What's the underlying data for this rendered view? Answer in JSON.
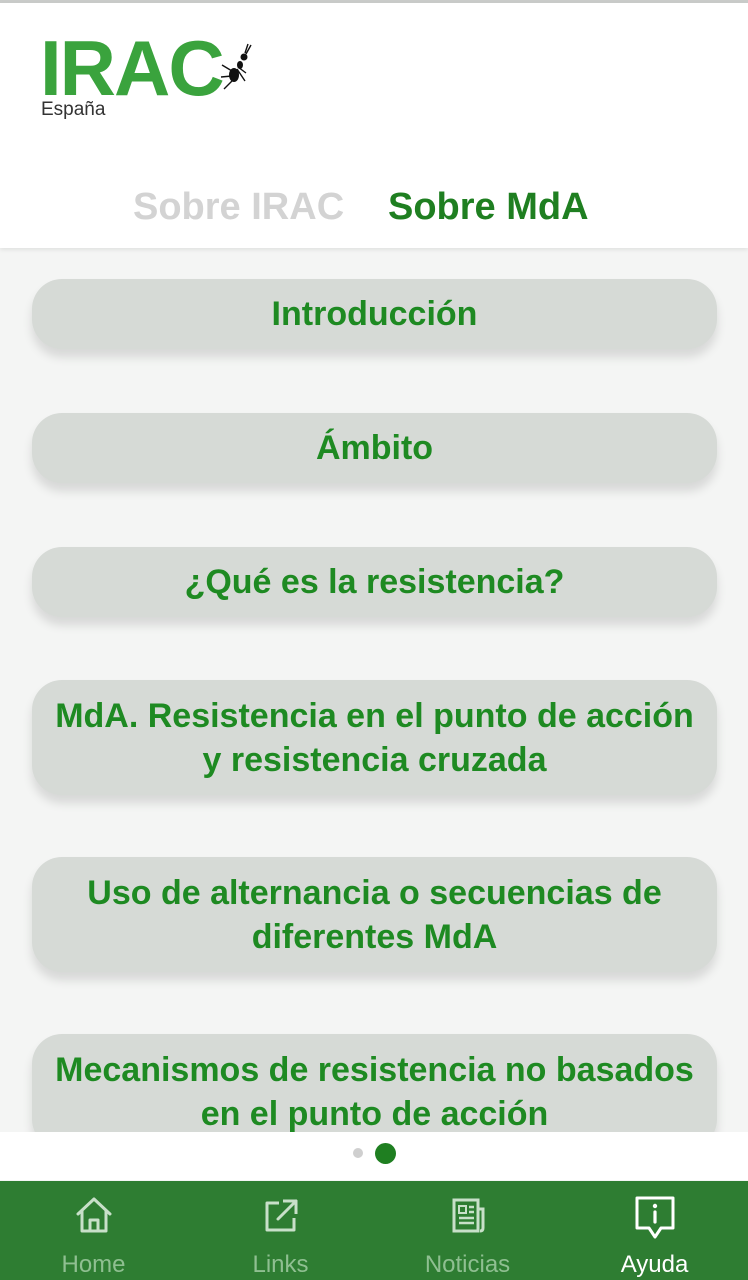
{
  "header": {
    "logo_text": "IRAC",
    "logo_subtitle": "España",
    "tabs": [
      {
        "label": "Sobre IRAC",
        "active": false
      },
      {
        "label": "Sobre MdA",
        "active": true
      }
    ]
  },
  "cards": [
    {
      "lines": [
        "Introducción"
      ]
    },
    {
      "lines": [
        "Ámbito"
      ]
    },
    {
      "lines": [
        "¿Qué es la resistencia?"
      ]
    },
    {
      "lines": [
        "MdA. Resistencia en el punto de acción",
        "y resistencia cruzada"
      ]
    },
    {
      "lines": [
        "Uso de alternancia o secuencias de",
        "diferentes MdA"
      ]
    },
    {
      "lines": [
        "Mecanismos de resistencia no basados",
        "en el punto de acción"
      ]
    }
  ],
  "pager": {
    "pages": 2,
    "current": 2
  },
  "bottom_nav": [
    {
      "label": "Home",
      "icon": "home-icon",
      "active": false
    },
    {
      "label": "Links",
      "icon": "external-link-icon",
      "active": false
    },
    {
      "label": "Noticias",
      "icon": "news-icon",
      "active": false
    },
    {
      "label": "Ayuda",
      "icon": "info-icon",
      "active": true
    }
  ],
  "colors": {
    "brand_green": "#3aa33d",
    "active_green": "#1f7f21",
    "nav_background": "#2e7d32",
    "card_background": "#d6dad6"
  }
}
